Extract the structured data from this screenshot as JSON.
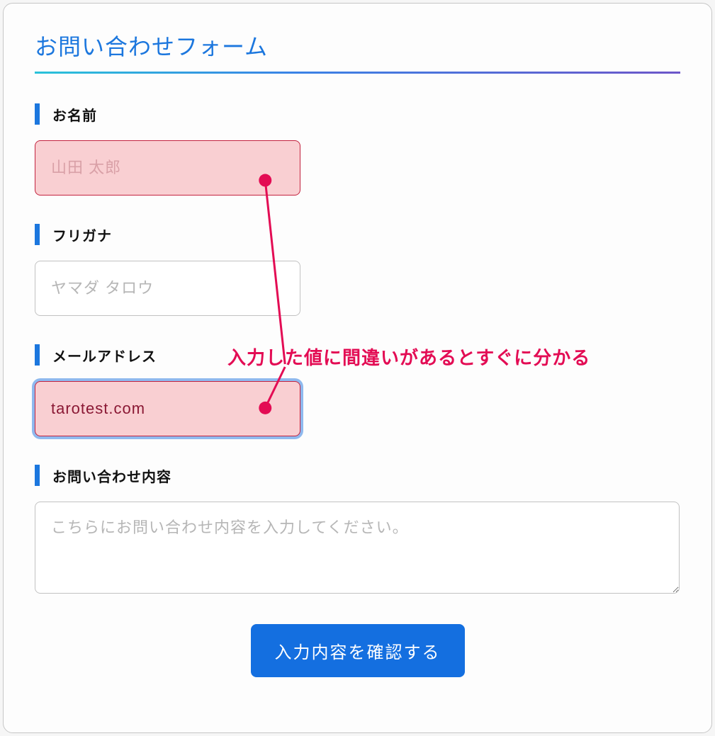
{
  "form": {
    "title": "お問い合わせフォーム",
    "fields": {
      "name": {
        "label": "お名前",
        "placeholder": "山田 太郎",
        "value": ""
      },
      "furigana": {
        "label": "フリガナ",
        "placeholder": "ヤマダ タロウ",
        "value": ""
      },
      "email": {
        "label": "メールアドレス",
        "placeholder": "",
        "value": "tarotest.com"
      },
      "message": {
        "label": "お問い合わせ内容",
        "placeholder": "こちらにお問い合わせ内容を入力してください。",
        "value": ""
      }
    },
    "submit_label": "入力内容を確認する"
  },
  "annotation": {
    "text": "入力した値に間違いがあるとすぐに分かる",
    "color": "#e30c54"
  }
}
